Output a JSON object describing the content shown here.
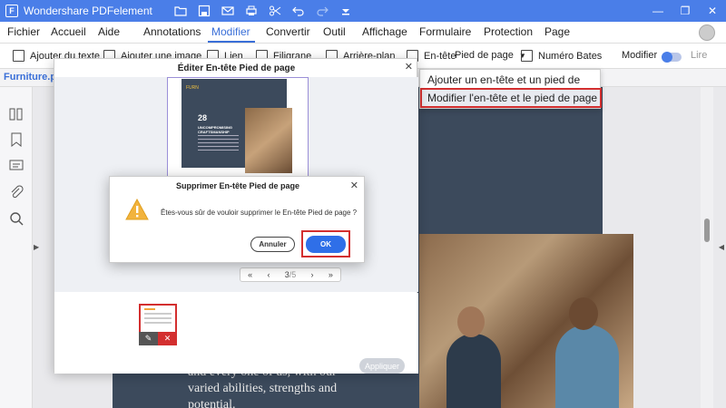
{
  "titlebar": {
    "app_title": "Wondershare PDFelement",
    "window_controls": [
      "—",
      "❐",
      "✕"
    ]
  },
  "menubar": {
    "items": [
      "Fichier",
      "Accueil",
      "Aide",
      "Annotations",
      "Modifier",
      "Convertir",
      "Outil",
      "Affichage",
      "Formulaire",
      "Protection",
      "Page"
    ],
    "active": "Modifier"
  },
  "toolbar": {
    "add_text": "Ajouter du texte",
    "add_image": "Ajouter une image",
    "link": "Lien",
    "watermark": "Filigrane",
    "background": "Arrière-plan",
    "header": "En-tête",
    "header_dropdown": "Pied de page",
    "bates": "Numéro Bates",
    "edit_label": "Modifier",
    "read_label": "Lire"
  },
  "tabstrip": {
    "file_tab": "Furniture.pdf"
  },
  "dropdown": {
    "items": [
      "Ajouter un en-tête et un pied de page",
      "Modifier l'en-tête et le pied de page"
    ],
    "highlighted_index": 1
  },
  "editor_dialog": {
    "title": "Éditer En-tête Pied de page",
    "preview": {
      "label": "FURN",
      "number": "28",
      "heading": "UNCOMPROMISING CRAFTSMANSHIP"
    },
    "pager": {
      "first": "«",
      "prev": "‹",
      "current": "3",
      "total": "/5",
      "next": "›",
      "last": "»"
    },
    "apply_button": "Appliquer"
  },
  "confirm_dialog": {
    "title": "Supprimer En-tête Pied de page",
    "message": "Êtes-vous sûr de vouloir supprimer le En-tête Pied de page ?",
    "cancel": "Annuler",
    "ok": "OK"
  },
  "document": {
    "text": "and every one of us, with our varied abilities, strengths and potential."
  },
  "colors": {
    "title_blue": "#4a7ee8",
    "accent_blue": "#3a6fd8",
    "highlight_red": "#d32f2f",
    "page_dark": "#3c4a5c"
  }
}
